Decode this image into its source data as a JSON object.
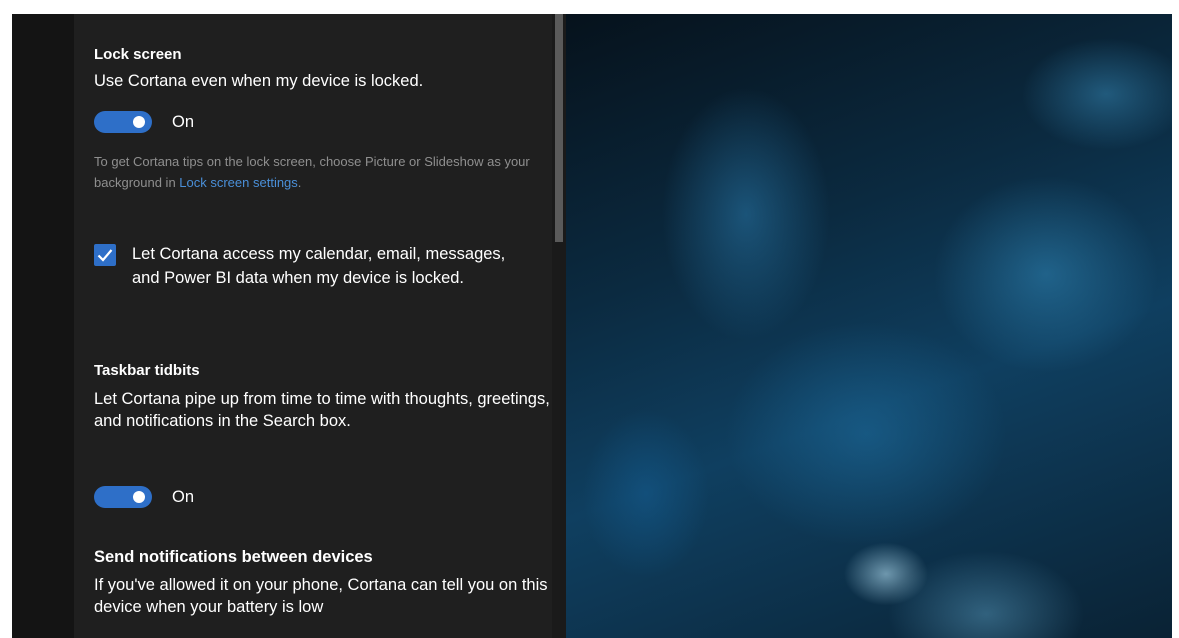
{
  "lock_screen": {
    "heading": "Lock screen",
    "description": "Use Cortana even when my device is locked.",
    "toggle_state": "On",
    "hint_prefix": "To get Cortana tips on the lock screen, choose Picture or Slideshow as your background in ",
    "hint_link": "Lock screen settings",
    "hint_suffix": ".",
    "checkbox_label": "Let Cortana access my calendar, email, messages, and Power BI data when my device is locked.",
    "checkbox_checked": true
  },
  "taskbar_tidbits": {
    "heading": "Taskbar tidbits",
    "description": "Let Cortana pipe up from time to time with thoughts, greetings, and notifications in the Search box.",
    "toggle_state": "On"
  },
  "send_notifications": {
    "heading": "Send notifications between devices",
    "description": "If you've allowed it on your phone, Cortana can tell you on this device when your battery is low"
  },
  "colors": {
    "accent": "#2e6fc8",
    "panel_bg": "#1f1f1f",
    "link": "#4a8fd8"
  }
}
